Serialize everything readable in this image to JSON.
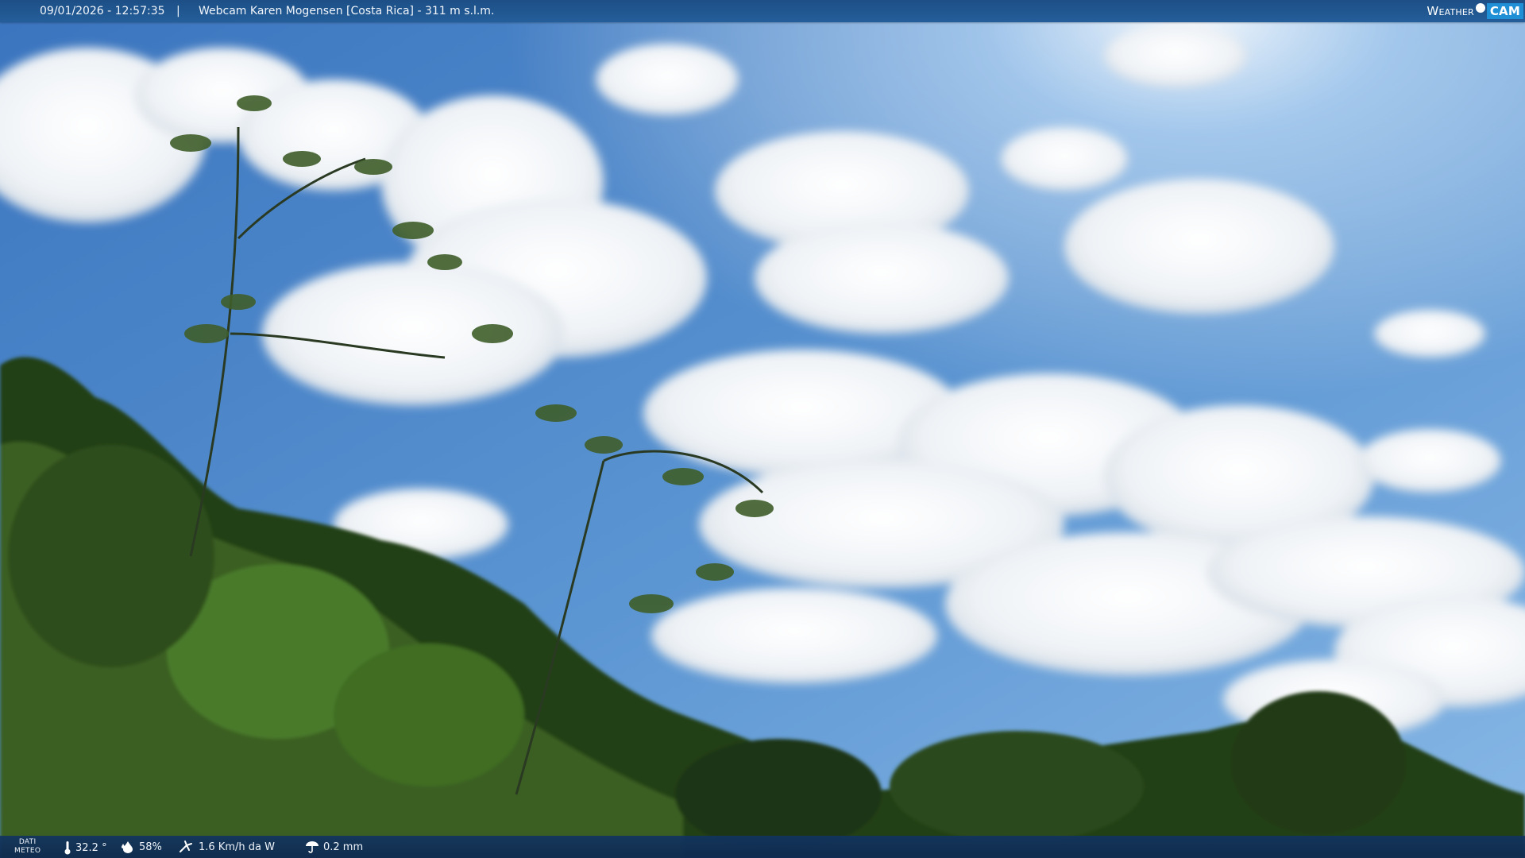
{
  "header": {
    "timestamp": "09/01/2026 - 12:57:35",
    "separator": "|",
    "title": "Webcam Karen Mogensen [Costa Rica] - 311 m s.l.m.",
    "brand": {
      "word": "Weather",
      "cam": "CAM"
    }
  },
  "footer": {
    "dati_line1": "DATI",
    "dati_line2": "METEO",
    "temperature": "32.2 °",
    "humidity": "58%",
    "wind": "1.6 Km/h da W",
    "rain": "0.2 mm"
  },
  "icons": [
    "thermometer-icon",
    "humidity-icon",
    "wind-icon",
    "rain-icon"
  ],
  "colors": {
    "sky": "#4d88cc",
    "cloud": "#ffffff",
    "foliage": "#2a4a1c",
    "bar": "#1f5590"
  }
}
